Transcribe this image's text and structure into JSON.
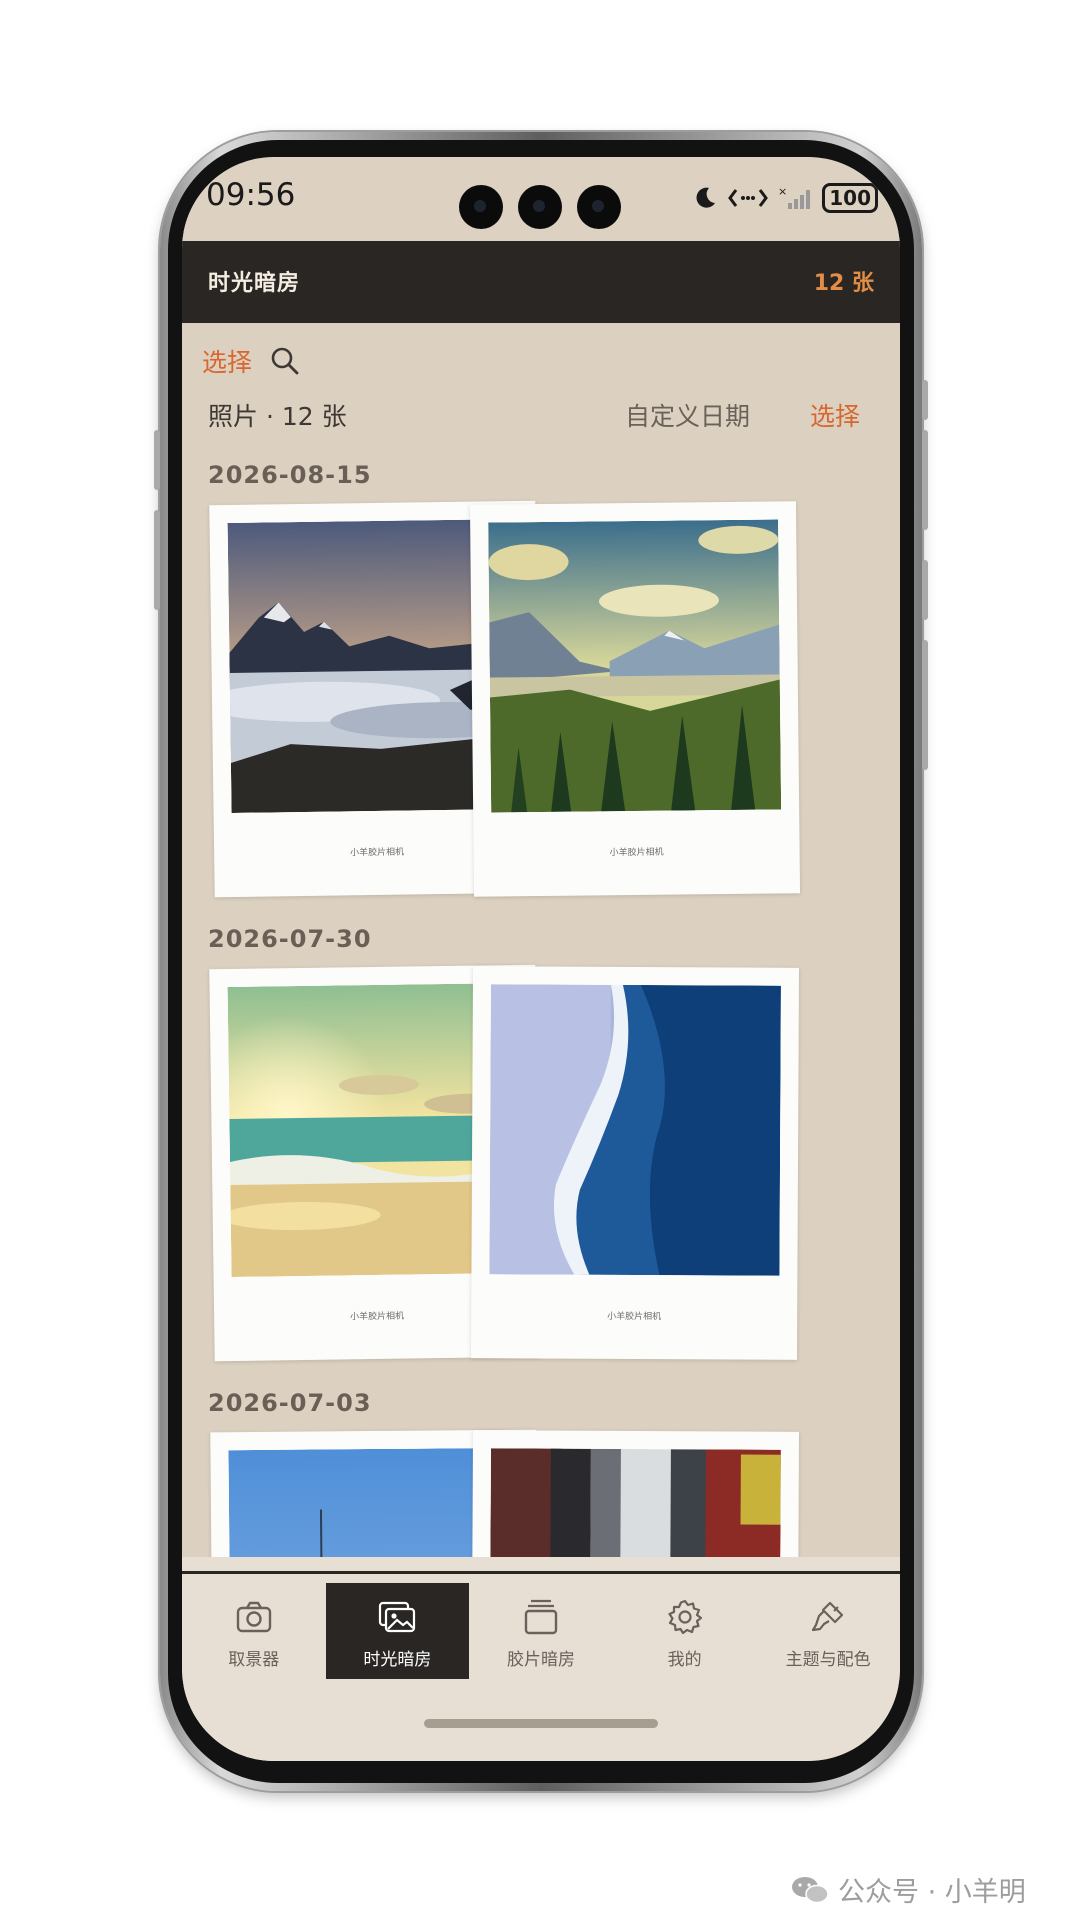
{
  "status_bar": {
    "time": "09:56",
    "battery": "100"
  },
  "header": {
    "title": "时光暗房",
    "count": "12 张"
  },
  "toolbar": {
    "select_label": "选择"
  },
  "summary": {
    "text": "照片 · 12 张",
    "custom_date": "自定义日期",
    "select_label": "选择"
  },
  "groups": [
    {
      "date": "2026-08-15",
      "photos": [
        {
          "caption": "小羊胶片相机",
          "scene": "mountain-sea-of-clouds"
        },
        {
          "caption": "小羊胶片相机",
          "scene": "mountain-forest-valley"
        }
      ]
    },
    {
      "date": "2026-07-30",
      "photos": [
        {
          "caption": "小羊胶片相机",
          "scene": "beach-sunset"
        },
        {
          "caption": "小羊胶片相机",
          "scene": "aerial-ocean-waves"
        }
      ]
    },
    {
      "date": "2026-07-03",
      "photos": [
        {
          "caption": "",
          "scene": "tower-blue-sky"
        },
        {
          "caption": "",
          "scene": "city-buildings"
        }
      ]
    }
  ],
  "nav": {
    "items": [
      {
        "label": "取景器",
        "icon": "camera-icon"
      },
      {
        "label": "时光暗房",
        "icon": "gallery-icon",
        "active": true
      },
      {
        "label": "胶片暗房",
        "icon": "film-stack-icon"
      },
      {
        "label": "我的",
        "icon": "gear-icon"
      },
      {
        "label": "主题与配色",
        "icon": "paint-brush-icon"
      }
    ]
  },
  "watermark": {
    "text": "公众号 · 小羊明"
  },
  "colors": {
    "accent": "#d8672f",
    "header_bg": "#2a2623",
    "screen_bg": "#dcd1c0"
  }
}
